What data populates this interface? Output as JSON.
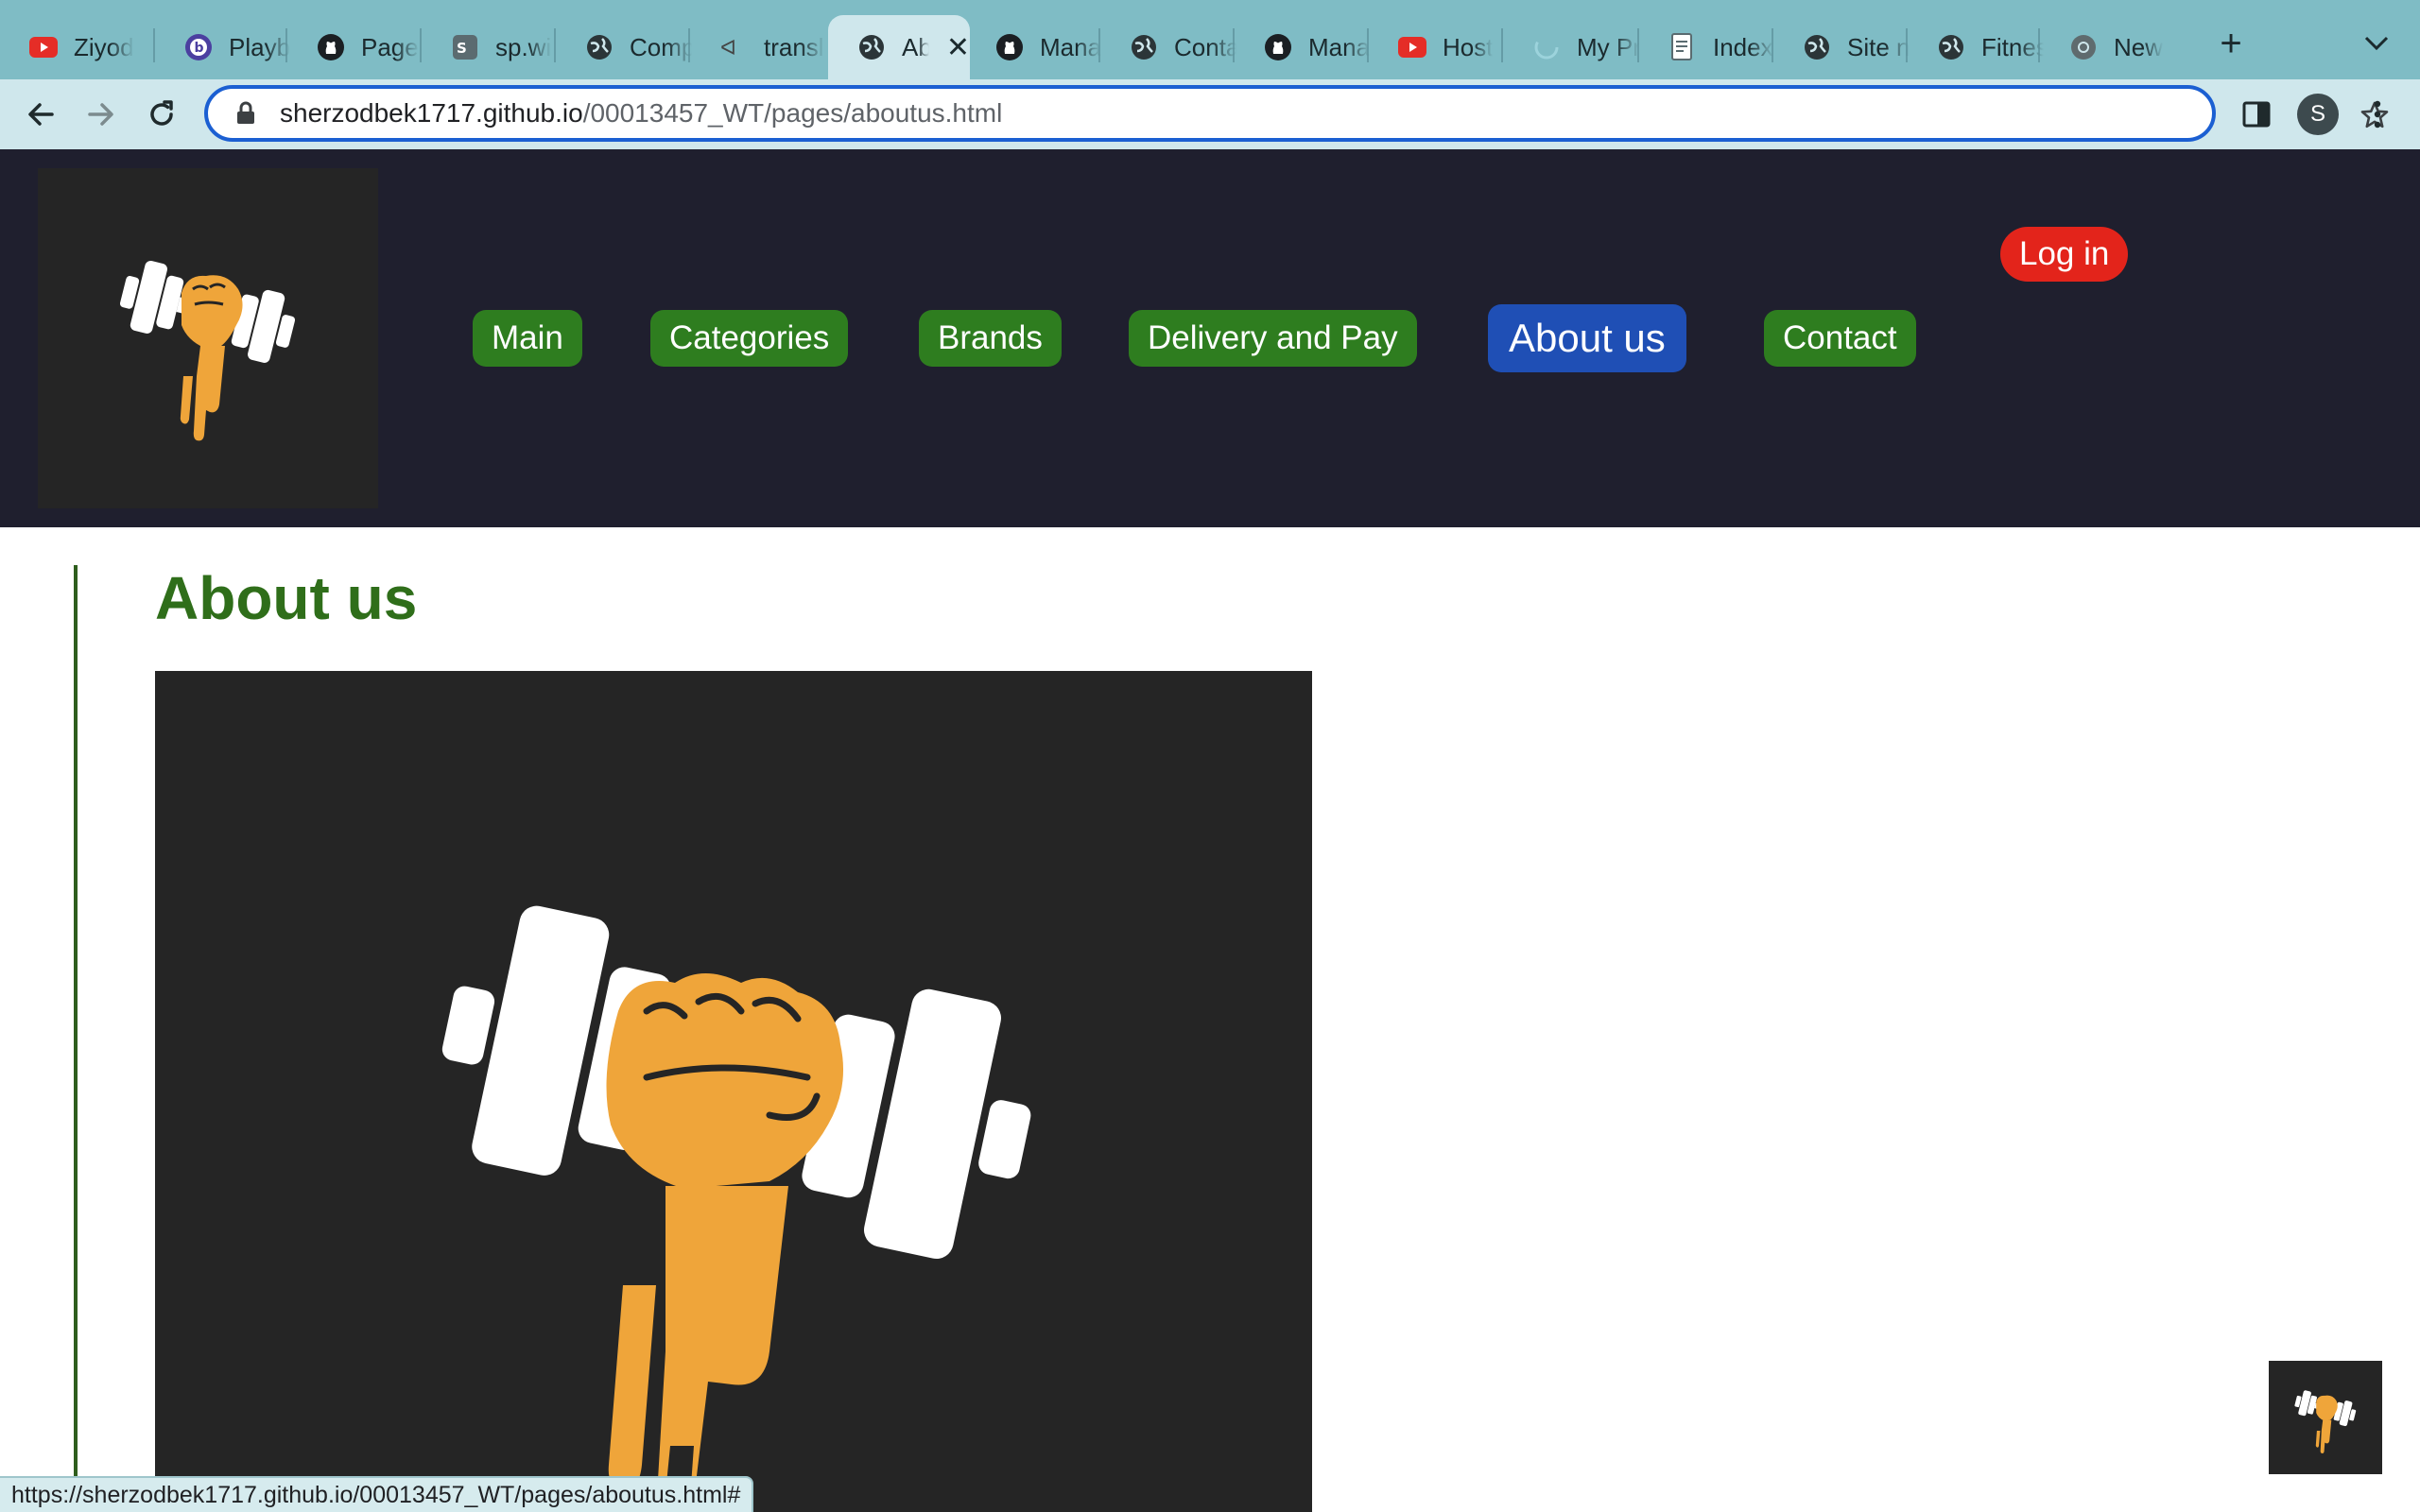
{
  "browser": {
    "tabs": [
      {
        "label": "Ziyod",
        "icon": "youtube-icon"
      },
      {
        "label": "Playb",
        "icon": "b-circle-icon"
      },
      {
        "label": "Page",
        "icon": "github-icon"
      },
      {
        "label": "sp.wi",
        "icon": "sp-icon"
      },
      {
        "label": "Comp",
        "icon": "globe-icon"
      },
      {
        "label": "transl",
        "icon": "translate-icon"
      },
      {
        "label": "Ab",
        "icon": "globe-icon",
        "active": true
      },
      {
        "label": "Mana",
        "icon": "github-icon"
      },
      {
        "label": "Conta",
        "icon": "globe-icon"
      },
      {
        "label": "Mana",
        "icon": "github-icon"
      },
      {
        "label": "Host",
        "icon": "youtube-icon"
      },
      {
        "label": "My Pr",
        "icon": "loading-icon"
      },
      {
        "label": "Index",
        "icon": "document-icon"
      },
      {
        "label": "Site n",
        "icon": "globe-icon"
      },
      {
        "label": "Fitnes",
        "icon": "globe-icon"
      },
      {
        "label": "New",
        "icon": "chrome-icon"
      }
    ],
    "address": {
      "domain": "sherzodbek1717.github.io",
      "path": "/00013457_WT/pages/aboutus.html"
    },
    "profile_initial": "S",
    "status_url": "https://sherzodbek1717.github.io/00013457_WT/pages/aboutus.html#"
  },
  "site": {
    "nav": [
      {
        "label": "Main"
      },
      {
        "label": "Categories"
      },
      {
        "label": "Brands"
      },
      {
        "label": "Delivery and Pay"
      },
      {
        "label": "About us",
        "active": true
      },
      {
        "label": "Contact"
      }
    ],
    "login_label": "Log in",
    "page_title": "About us"
  },
  "colors": {
    "tabstrip": "#7fbcc5",
    "header_bg": "#1f1f2e",
    "nav_green": "#2e7d1f",
    "nav_active_blue": "#1f4fb5",
    "login_red": "#e3241b",
    "title_green": "#2f6e1a",
    "logo_orange": "#efa53a"
  }
}
